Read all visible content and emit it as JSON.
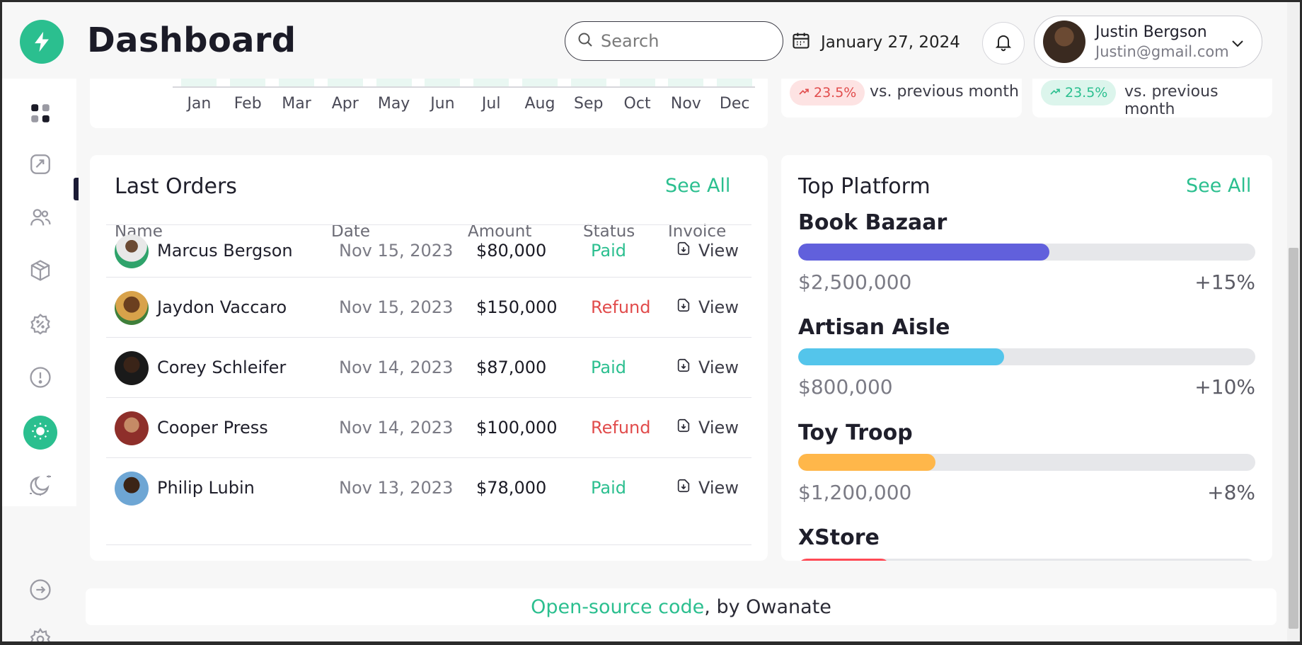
{
  "header": {
    "title": "Dashboard",
    "search_placeholder": "Search",
    "date": "January 27, 2024",
    "user_name": "Justin Bergson",
    "user_email": "Justin@gmail.com"
  },
  "sidebar": {
    "icons": [
      "dashboard-icon",
      "chart-icon",
      "users-icon",
      "box-icon",
      "discount-icon",
      "info-icon",
      "sun-icon",
      "moon-icon",
      "logout-icon",
      "settings-icon"
    ]
  },
  "sales_chart": {
    "months": [
      "Jan",
      "Feb",
      "Mar",
      "Apr",
      "May",
      "Jun",
      "Jul",
      "Aug",
      "Sep",
      "Oct",
      "Nov",
      "Dec"
    ]
  },
  "stats": [
    {
      "change": "23.5%",
      "trend": "up",
      "tone": "red",
      "label": "vs. previous month"
    },
    {
      "change": "23.5%",
      "trend": "up",
      "tone": "green",
      "label": "vs. previous month"
    }
  ],
  "orders": {
    "title": "Last Orders",
    "see_all": "See All",
    "columns": [
      "Name",
      "Date",
      "Amount",
      "Status",
      "Invoice"
    ],
    "rows": [
      {
        "name": "Marcus Bergson",
        "date": "Nov 15, 2023",
        "amount": "$80,000",
        "status": "Paid",
        "invoice": "View"
      },
      {
        "name": "Jaydon Vaccaro",
        "date": "Nov 15, 2023",
        "amount": "$150,000",
        "status": "Refund",
        "invoice": "View"
      },
      {
        "name": "Corey Schleifer",
        "date": "Nov 14, 2023",
        "amount": "$87,000",
        "status": "Paid",
        "invoice": "View"
      },
      {
        "name": "Cooper Press",
        "date": "Nov 14, 2023",
        "amount": "$100,000",
        "status": "Refund",
        "invoice": "View"
      },
      {
        "name": "Philip Lubin",
        "date": "Nov 13, 2023",
        "amount": "$78,000",
        "status": "Paid",
        "invoice": "View"
      }
    ]
  },
  "platforms": {
    "title": "Top Platform",
    "see_all": "See All",
    "items": [
      {
        "name": "Book Bazaar",
        "value": "$2,500,000",
        "change": "+15%",
        "progress": 0.55,
        "color": "#6160dc"
      },
      {
        "name": "Artisan Aisle",
        "value": "$800,000",
        "change": "+10%",
        "progress": 0.45,
        "color": "#54c5eb"
      },
      {
        "name": "Toy Troop",
        "value": "$1,200,000",
        "change": "+8%",
        "progress": 0.3,
        "color": "#ffb74a"
      },
      {
        "name": "XStore",
        "value": "",
        "change": "",
        "progress": 0.2,
        "color": "#ff4a55"
      }
    ]
  },
  "footer": {
    "link_text": "Open-source code",
    "by_text": ", by Owanate"
  },
  "colors": {
    "accent": "#2bbf8f",
    "refund": "#e14c4c"
  }
}
